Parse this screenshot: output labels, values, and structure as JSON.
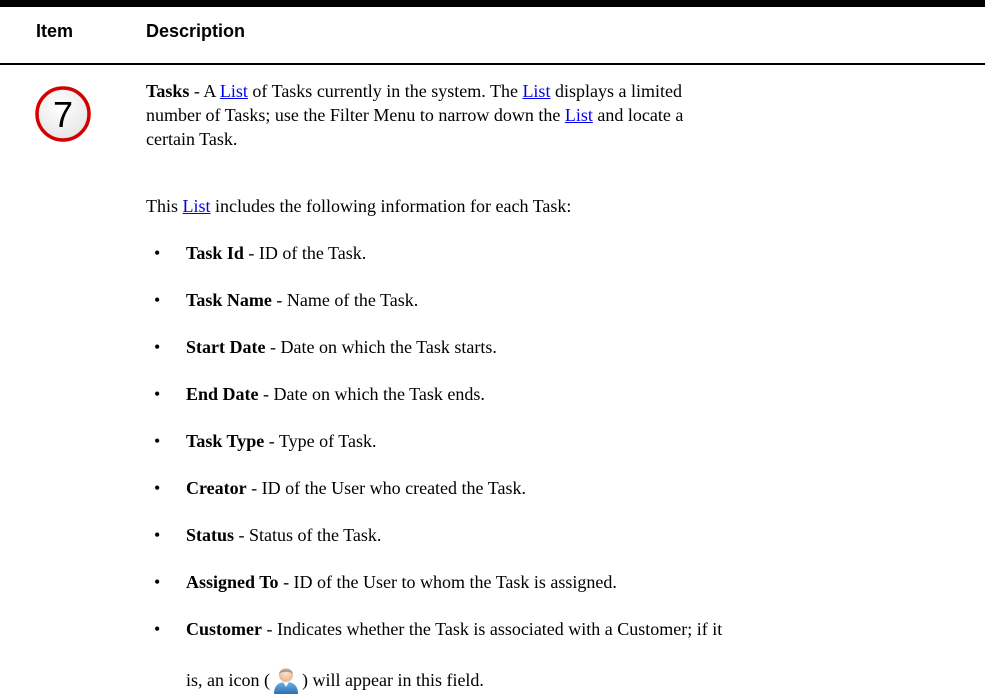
{
  "table": {
    "header": {
      "item": "Item",
      "description": "Description"
    },
    "item_number": "7",
    "intro": {
      "term": "Tasks",
      "p1_a": " - A ",
      "link": "List",
      "p1_b": " of Tasks currently in the system. The ",
      "p1_c": " displays a limited",
      "p1_d": "number of Tasks; use the Filter Menu to narrow down the ",
      "p1_e": " and locate a",
      "p1_f": "certain Task."
    },
    "lead": {
      "a": "This ",
      "b": " includes the following information for each Task:"
    },
    "fields": [
      {
        "term": "Task Id",
        "desc": " - ID of the Task."
      },
      {
        "term": "Task Name",
        "desc": " - Name of the Task."
      },
      {
        "term": "Start Date",
        "desc": " - Date on which the Task starts."
      },
      {
        "term": "End Date",
        "desc": " - Date on which the Task ends."
      },
      {
        "term": "Task Type",
        "desc": " - Type of Task."
      },
      {
        "term": "Creator",
        "desc": " - ID of the User who created the Task."
      },
      {
        "term": "Status",
        "desc": " - Status of the Task."
      },
      {
        "term": "Assigned To",
        "desc": " - ID of the User to whom the Task is assigned."
      },
      {
        "term": "Customer",
        "desc": " - Indicates whether the Task is associated with a Customer; if it"
      }
    ],
    "customer_line2": {
      "a": "is, an icon (",
      "b": ") will appear in this field."
    },
    "icons": {
      "badge": "circled-number-icon",
      "customer": "user-icon"
    },
    "colors": {
      "badge_ring": "#d40000",
      "link": "#0000ee"
    }
  }
}
